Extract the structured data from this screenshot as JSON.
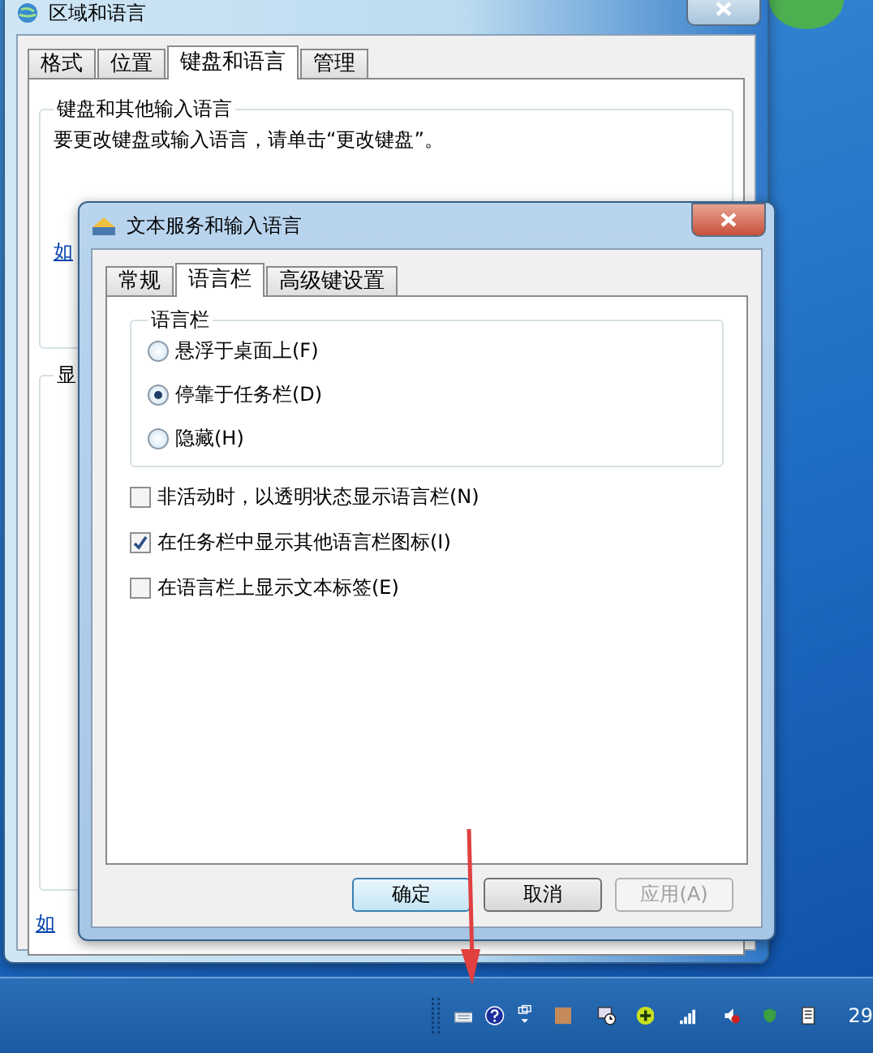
{
  "background_window": {
    "title": "区域和语言",
    "tabs": [
      {
        "label": "格式",
        "selected": false
      },
      {
        "label": "位置",
        "selected": false
      },
      {
        "label": "键盘和语言",
        "selected": true
      },
      {
        "label": "管理",
        "selected": false
      }
    ],
    "group_title": "键盘和其他输入语言",
    "instruction": "要更改键盘或输入语言，请单击“更改键盘”。",
    "link_1": "如",
    "group_2_title": "显",
    "link_2": "如"
  },
  "dialog": {
    "title": "文本服务和输入语言",
    "tabs": [
      {
        "label": "常规",
        "selected": false
      },
      {
        "label": "语言栏",
        "selected": true
      },
      {
        "label": "高级键设置",
        "selected": false
      }
    ],
    "group_title": "语言栏",
    "radios": [
      {
        "label": "悬浮于桌面上(F)",
        "selected": false
      },
      {
        "label": "停靠于任务栏(D)",
        "selected": true
      },
      {
        "label": "隐藏(H)",
        "selected": false
      }
    ],
    "checkboxes": [
      {
        "label": "非活动时，以透明状态显示语言栏(N)",
        "checked": false
      },
      {
        "label": "在任务栏中显示其他语言栏图标(I)",
        "checked": true
      },
      {
        "label": "在语言栏上显示文本标签(E)",
        "checked": false
      }
    ],
    "buttons": [
      {
        "label": "确定",
        "kind": "default"
      },
      {
        "label": "取消",
        "kind": "normal"
      },
      {
        "label": "应用(A)",
        "kind": "disabled"
      }
    ]
  },
  "taskbar": {
    "clock": "29"
  }
}
